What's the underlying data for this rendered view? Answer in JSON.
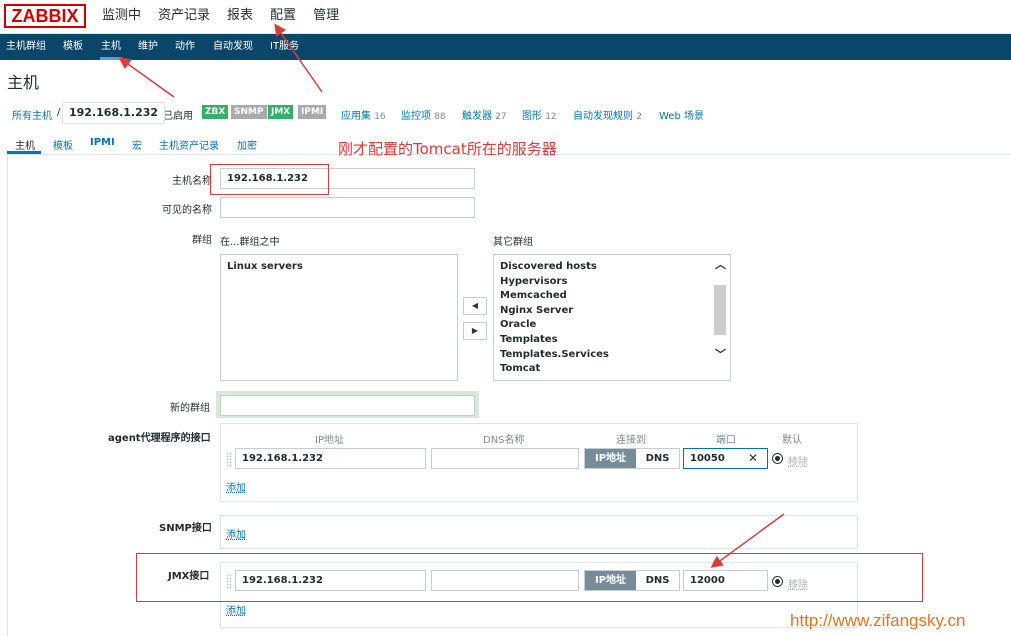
{
  "header": {
    "logo": "ZABBIX",
    "nav": [
      "监测中",
      "资产记录",
      "报表",
      "配置",
      "管理"
    ]
  },
  "subnav": {
    "items": [
      "主机群组",
      "模板",
      "主机",
      "维护",
      "动作",
      "自动发现",
      "IT服务"
    ],
    "active": "主机"
  },
  "page": {
    "title": "主机"
  },
  "breadcrumb": {
    "all_hosts": "所有主机",
    "separator": "/",
    "host": "192.168.1.232",
    "status": "已启用",
    "tags": [
      "ZBX",
      "SNMP",
      "JMX",
      "IPMI"
    ],
    "links": [
      {
        "label": "应用集",
        "count": "16"
      },
      {
        "label": "监控项",
        "count": "88"
      },
      {
        "label": "触发器",
        "count": "27"
      },
      {
        "label": "图形",
        "count": "12"
      },
      {
        "label": "自动发现规则",
        "count": "2"
      },
      {
        "label": "Web 场景",
        "count": ""
      }
    ]
  },
  "tabs": [
    "主机",
    "模板",
    "IPMI",
    "宏",
    "主机资产记录",
    "加密"
  ],
  "form": {
    "host_name_label": "主机名称",
    "host_name_value": "192.168.1.232",
    "visible_name_label": "可见的名称",
    "visible_name_value": "",
    "groups_label": "群组",
    "in_groups_label": "在...群组之中",
    "other_groups_label": "其它群组",
    "in_groups": [
      "Linux servers"
    ],
    "other_groups": [
      "Discovered hosts",
      "Hypervisors",
      "Memcached",
      "Nginx Server",
      "Oracle",
      "Templates",
      "Templates.Services",
      "Tomcat"
    ],
    "move_left": "◀",
    "move_right": "▶",
    "new_group_label": "新的群组",
    "new_group_value": "",
    "agent_label": "agent代理程序的接口",
    "col_ip": "IP地址",
    "col_dns": "DNS名称",
    "col_connect": "连接到",
    "col_port": "端口",
    "col_default": "默认",
    "agent_ip": "192.168.1.232",
    "agent_dns": "",
    "connect_ip": "IP地址",
    "connect_dns": "DNS",
    "agent_port": "10050",
    "clear_icon": "✕",
    "remove": "移除",
    "add": "添加",
    "snmp_label": "SNMP接口",
    "jmx_label": "JMX接口",
    "jmx_ip": "192.168.1.232",
    "jmx_dns": "",
    "jmx_port": "12000"
  },
  "annotation": {
    "note": "刚才配置的Tomcat所在的服务器",
    "watermark": "http://www.zifangsky.cn",
    "color": "#e03a3a"
  },
  "colors": {
    "nav_bg": "#0a466a",
    "link": "#0275b8",
    "enabled": "#34af67",
    "logo": "#d40000"
  }
}
